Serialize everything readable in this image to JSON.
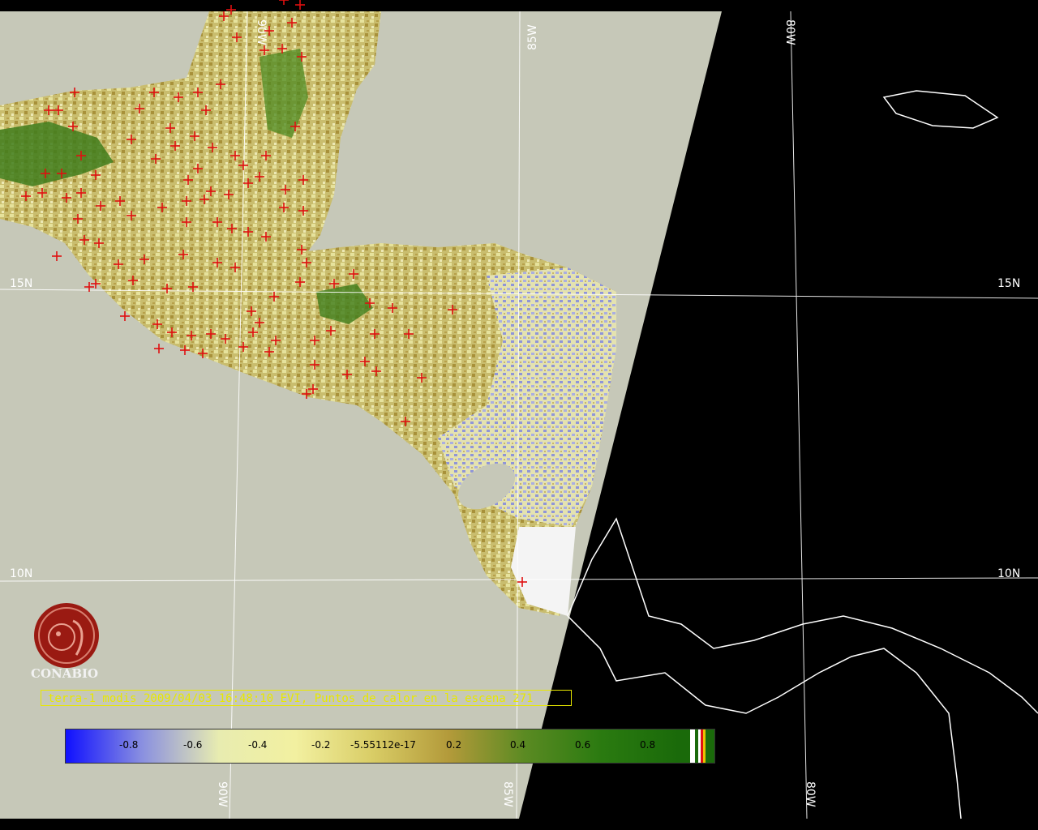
{
  "caption": "terra-1 modis 2009/04/03 16:48:10 EVI, Puntos de calor en la escena 271",
  "logo": {
    "text": "CONABIO"
  },
  "grid_labels": {
    "lat_15n_left": "15N",
    "lat_15n_right": "15N",
    "lat_10n_left": "10N",
    "lat_10n_right": "10N",
    "lon_85w_top": "85W",
    "lon_80w_top": "80W",
    "lon_90w_top": "90W",
    "lon_90w_bottom": "90W",
    "lon_85w_bottom": "85W",
    "lon_80w_bottom": "80W"
  },
  "colorbar": {
    "labels": [
      "-0.8",
      "-0.6",
      "-0.4",
      "-0.2",
      "-5.55112e-17",
      "0.2",
      "0.4",
      "0.6",
      "0.8"
    ],
    "colors": [
      "#1010ff",
      "#8a90e0",
      "#e8ecb0",
      "#f2f0a0",
      "#d9cd66",
      "#b39a3a",
      "#5a8a22",
      "#2a7a10",
      "#1a6a0a"
    ]
  },
  "colors": {
    "background_dark": "#000000",
    "ocean_processed": "#c6c8b8",
    "hotspot": "#e01010",
    "coastline": "#ffffff",
    "caption": "#e8e800"
  }
}
